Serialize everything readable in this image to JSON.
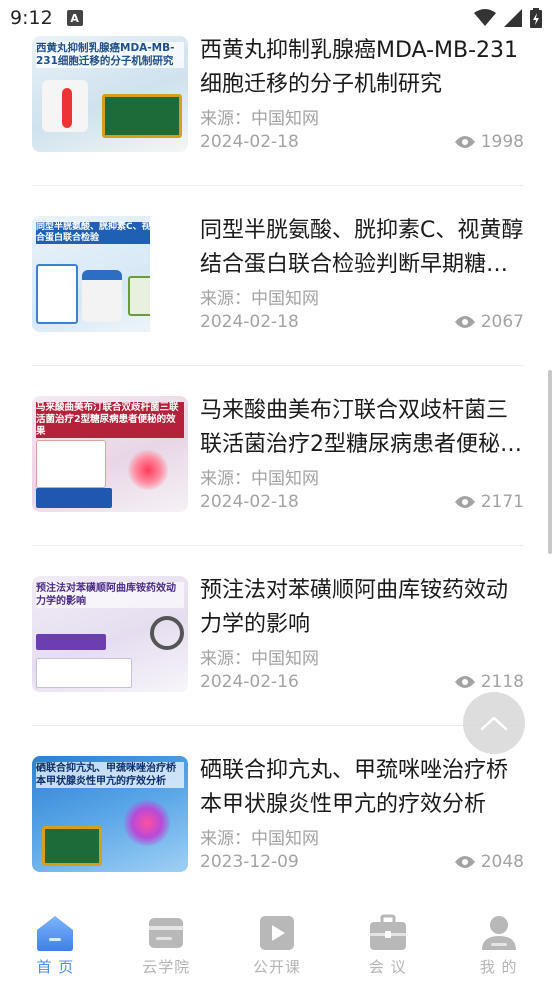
{
  "status_bar": {
    "time": "9:12",
    "notification_letter": "A"
  },
  "articles": [
    {
      "thumb_title": "西黄丸抑制乳腺癌MDA-MB-231细胞迁移的分子机制研究",
      "title": "西黄丸抑制乳腺癌MDA-MB-231细胞迁移的分子机制研究",
      "source": "来源：中国知网",
      "date": "2024-02-18",
      "views": "1998"
    },
    {
      "thumb_title": "同型半胱氨酸、胱抑素C、视黄醇结合蛋白联合检验",
      "title": "同型半胱氨酸、胱抑素C、视黄醇结合蛋白联合检验判断早期糖尿病肾病的价值",
      "source": "来源：中国知网",
      "date": "2024-02-18",
      "views": "2067"
    },
    {
      "thumb_title": "马来酸曲美布汀联合双歧杆菌三联活菌治疗2型糖尿病患者便秘的效果",
      "title": "马来酸曲美布汀联合双歧杆菌三联活菌治疗2型糖尿病患者便秘的效果",
      "source": "来源：中国知网",
      "date": "2024-02-18",
      "views": "2171"
    },
    {
      "thumb_title": "预注法对苯磺顺阿曲库铵药效动力学的影响",
      "title": "预注法对苯磺顺阿曲库铵药效动力学的影响",
      "source": "来源：中国知网",
      "date": "2024-02-16",
      "views": "2118"
    },
    {
      "thumb_title": "硒联合抑亢丸、甲巯咪唑治疗桥本甲状腺炎性甲亢的疗效分析",
      "title": "硒联合抑亢丸、甲巯咪唑治疗桥本甲状腺炎性甲亢的疗效分析",
      "source": "来源：中国知网",
      "date": "2023-12-09",
      "views": "2048"
    }
  ],
  "tabbar": {
    "items": [
      {
        "label": "首 页",
        "icon": "home-icon",
        "active": true
      },
      {
        "label": "云学院",
        "icon": "wallet-icon",
        "active": false
      },
      {
        "label": "公开课",
        "icon": "video-icon",
        "active": false
      },
      {
        "label": "会 议",
        "icon": "briefcase-icon",
        "active": false
      },
      {
        "label": "我 的",
        "icon": "user-icon",
        "active": false
      }
    ]
  },
  "colors": {
    "accent": "#4d8ff2",
    "muted": "#a3a3a3",
    "inactive_tab": "#b5b5b5"
  }
}
